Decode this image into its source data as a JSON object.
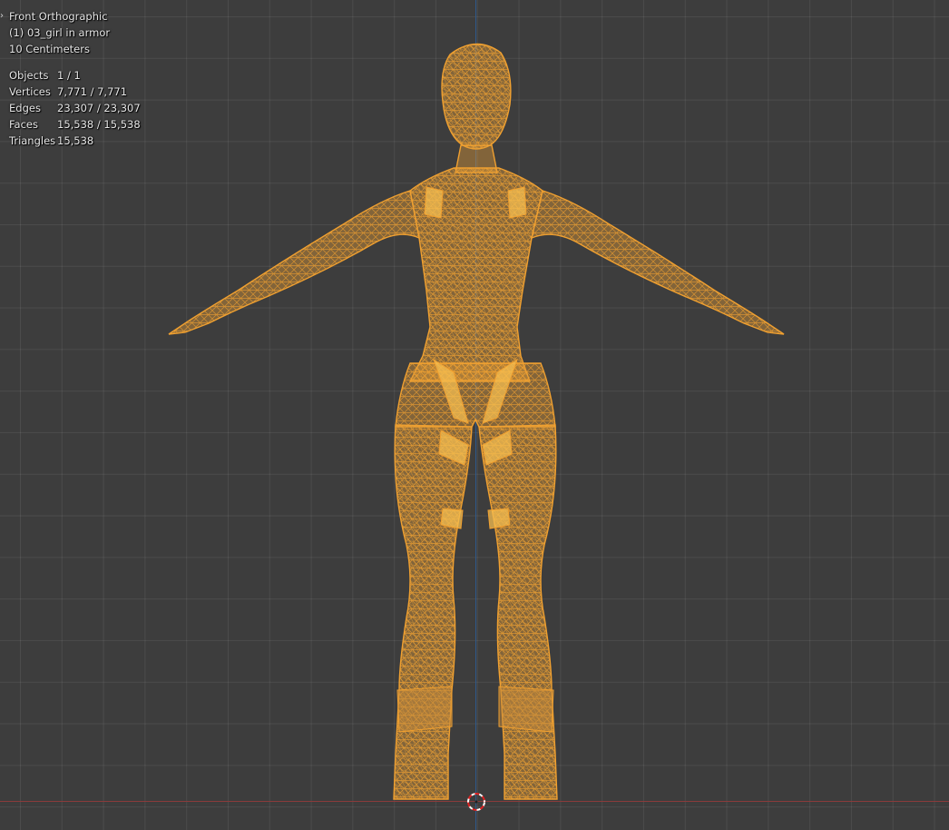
{
  "overlay": {
    "view_name": "Front Orthographic",
    "object_name": "(1) 03_girl in armor",
    "grid_scale": "10 Centimeters",
    "stats": [
      {
        "label": "Objects",
        "value": "1 / 1"
      },
      {
        "label": "Vertices",
        "value": "7,771 / 7,771"
      },
      {
        "label": "Edges",
        "value": "23,307 / 23,307"
      },
      {
        "label": "Faces",
        "value": "15,538 / 15,538"
      },
      {
        "label": "Triangles",
        "value": "15,538"
      }
    ]
  },
  "colors": {
    "background": "#3d3d3d",
    "wireframe": "#f0a030",
    "mesh_fill": "#e39a38",
    "z_axis": "#2f5a8c",
    "x_axis": "#8a3b3b"
  }
}
